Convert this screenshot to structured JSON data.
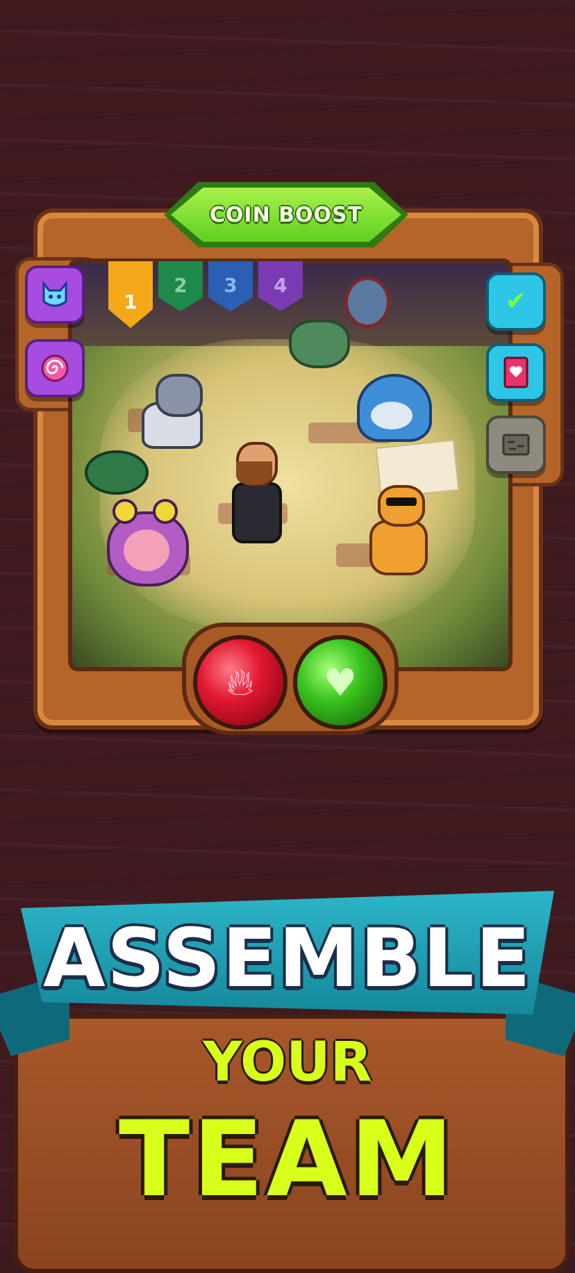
{
  "game": {
    "top_banner": {
      "label": "COIN BOOST"
    },
    "team_tabs": [
      {
        "label": "1",
        "selected": true,
        "color": "#f4a81a"
      },
      {
        "label": "2",
        "selected": false,
        "color": "#1e8a4a"
      },
      {
        "label": "3",
        "selected": false,
        "color": "#2a5fb4"
      },
      {
        "label": "4",
        "selected": false,
        "color": "#7a3ab4"
      }
    ],
    "left_buttons": [
      {
        "icon": "demon-face-icon",
        "color": "#a84be0"
      },
      {
        "icon": "swirl-icon",
        "color": "#a84be0"
      }
    ],
    "right_buttons": [
      {
        "icon": "checkmark-icon",
        "color": "#2dc6e6"
      },
      {
        "icon": "heart-card-icon",
        "color": "#2dc6e6"
      },
      {
        "icon": "map-icon",
        "color": "#8f8a7e"
      }
    ],
    "characters": [
      "wolf",
      "shark",
      "bearded-hero",
      "pink-frog",
      "giraffe-with-sunglasses"
    ],
    "orbs": [
      {
        "icon": "fire-icon",
        "color": "#e01830"
      },
      {
        "icon": "heart-icon",
        "color": "#3ac41e"
      }
    ]
  },
  "promo": {
    "line1": "ASSEMBLE",
    "line2": "YOUR",
    "line3": "TEAM",
    "accent_color": "#d8ff1a",
    "ribbon_color": "#2cb6c8"
  }
}
